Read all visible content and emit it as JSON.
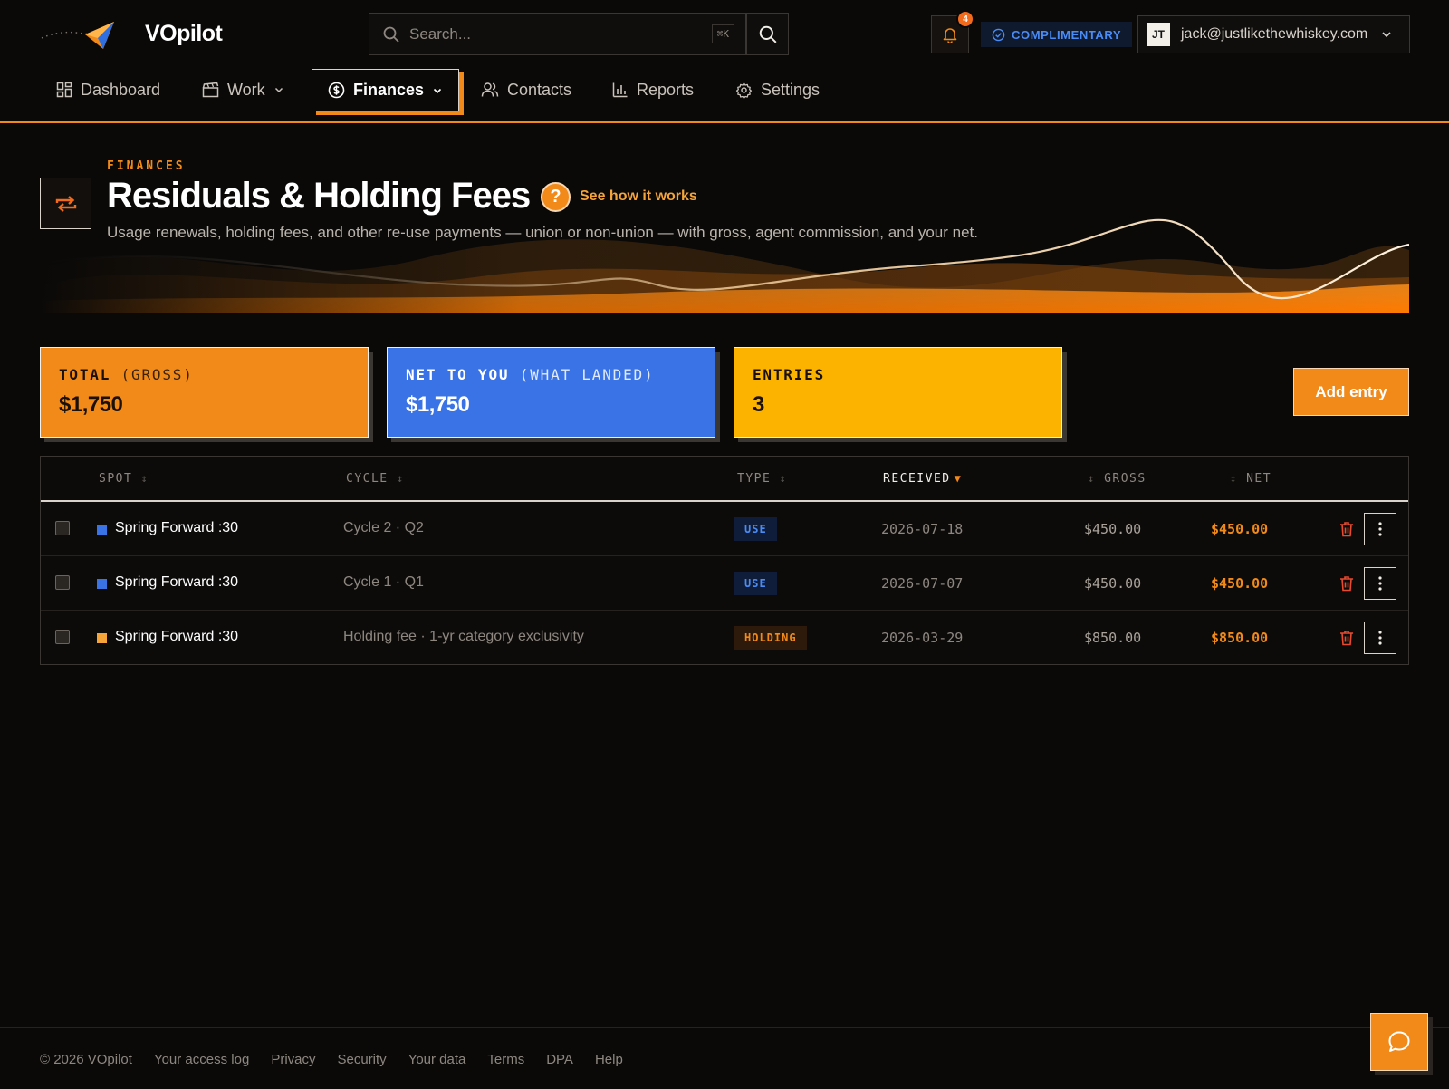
{
  "app": {
    "name": "VOpilot"
  },
  "search": {
    "placeholder": "Search...",
    "shortcut": "⌘K"
  },
  "notifications": {
    "count": "4"
  },
  "plan": {
    "label": "COMPLIMENTARY"
  },
  "account": {
    "initials": "JT",
    "email": "jack@justlikethewhiskey.com"
  },
  "nav": {
    "items": [
      {
        "label": "Dashboard",
        "icon": "grid-icon"
      },
      {
        "label": "Work",
        "icon": "clapperboard-icon"
      },
      {
        "label": "Finances",
        "icon": "dollar-circle-icon",
        "active": true
      },
      {
        "label": "Contacts",
        "icon": "users-icon"
      },
      {
        "label": "Reports",
        "icon": "bar-chart-icon"
      },
      {
        "label": "Settings",
        "icon": "gear-icon"
      }
    ]
  },
  "hero": {
    "eyebrow": "FINANCES",
    "title": "Residuals & Holding Fees",
    "help_icon": "?",
    "help_link": "See how it works",
    "subtitle": "Usage renewals, holding fees, and other re-use payments — union or non-union — with gross, agent commission, and your net."
  },
  "stats": {
    "total": {
      "label": "TOTAL",
      "sub": "(GROSS)",
      "value": "$1,750"
    },
    "net": {
      "label": "NET TO YOU",
      "sub": "(WHAT LANDED)",
      "value": "$1,750"
    },
    "entries": {
      "label": "ENTRIES",
      "value": "3"
    }
  },
  "actions": {
    "add_entry": "Add entry"
  },
  "table": {
    "columns": {
      "spot": "SPOT",
      "cycle": "CYCLE",
      "type": "TYPE",
      "received": "RECEIVED",
      "gross": "GROSS",
      "net": "NET"
    },
    "sort": {
      "column": "received",
      "direction": "desc"
    },
    "rows": [
      {
        "spot": "Spring Forward :30",
        "cycle": "Cycle 2 · Q2",
        "type": "USE",
        "received": "2026-07-18",
        "gross": "$450.00",
        "net": "$450.00",
        "color": "#3a73e6"
      },
      {
        "spot": "Spring Forward :30",
        "cycle": "Cycle 1 · Q1",
        "type": "USE",
        "received": "2026-07-07",
        "gross": "$450.00",
        "net": "$450.00",
        "color": "#3a73e6"
      },
      {
        "spot": "Spring Forward :30",
        "cycle": "Holding fee · 1-yr category exclusivity",
        "type": "HOLDING",
        "received": "2026-03-29",
        "gross": "$850.00",
        "net": "$850.00",
        "color": "#f5a43a"
      }
    ]
  },
  "footer": {
    "copyright": "© 2026 VOpilot",
    "links": [
      "Your access log",
      "Privacy",
      "Security",
      "Your data",
      "Terms",
      "DPA",
      "Help"
    ]
  },
  "colors": {
    "accent": "#f28a1a",
    "blue": "#3a73e6",
    "yellow": "#fbb300",
    "background": "#0a0908"
  }
}
